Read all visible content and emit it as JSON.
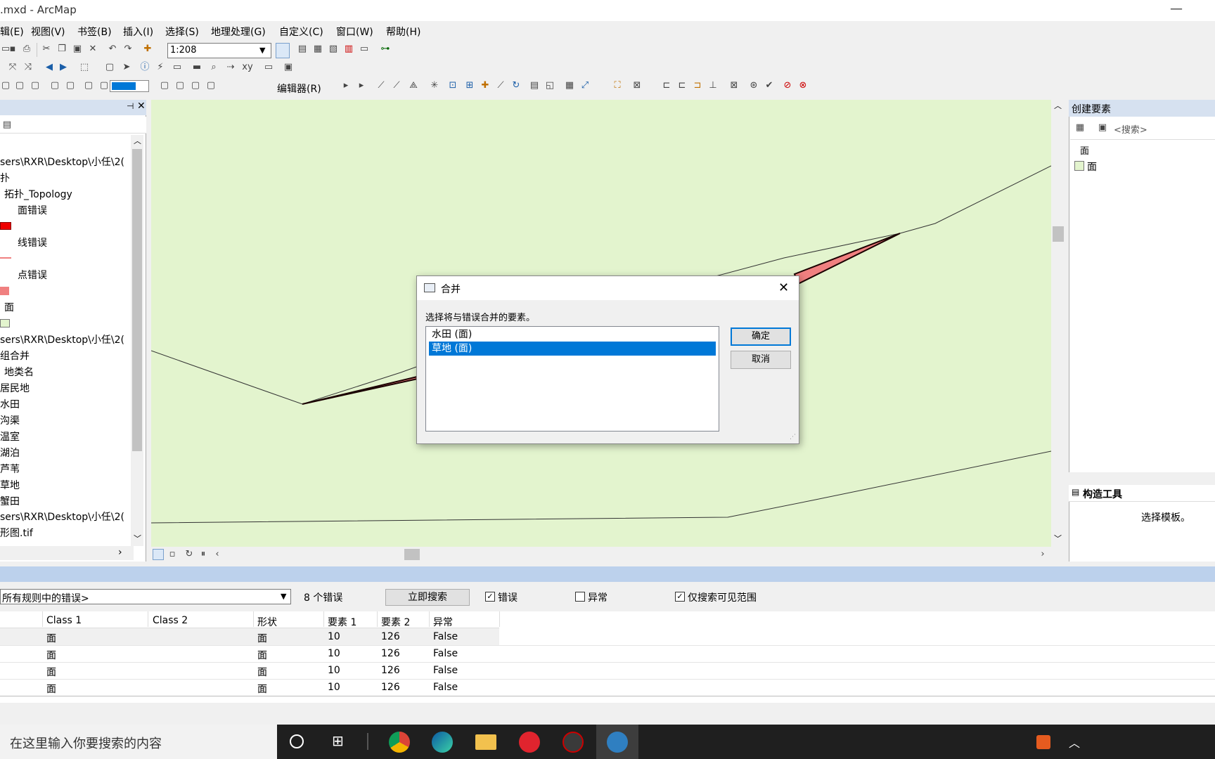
{
  "window": {
    "title": ".mxd - ArcMap",
    "minimize_glyph": "—"
  },
  "menu": [
    "辑(E)",
    "视图(V)",
    "书签(B)",
    "插入(I)",
    "选择(S)",
    "地理处理(G)",
    "自定义(C)",
    "窗口(W)",
    "帮助(H)"
  ],
  "toolbar": {
    "scale": "1:208",
    "editor": "编辑器(R)"
  },
  "toc": {
    "lines": [
      "sers\\RXR\\Desktop\\小任\\2(",
      "扑",
      "拓扑_Topology",
      "面错误",
      "线错误",
      "点错误",
      "面",
      "sers\\RXR\\Desktop\\小任\\2(",
      "组合并",
      "地类名",
      "居民地",
      "水田",
      "沟渠",
      "温室",
      "湖泊",
      "芦苇",
      "草地",
      "蟹田",
      "sers\\RXR\\Desktop\\小任\\2(",
      "形图.tif"
    ]
  },
  "create_features": {
    "title": "创建要素",
    "search_placeholder": "<搜索>",
    "group": "面",
    "template": "面"
  },
  "construct_tools": {
    "title": "构造工具",
    "hint": "选择模板。"
  },
  "errors": {
    "rule": "所有规则中的错误>",
    "count": "8 个错误",
    "search_button": "立即搜索",
    "chk_errors": "错误",
    "chk_exceptions": "异常",
    "chk_visible": "仅搜索可见范围",
    "columns": [
      "Class 1",
      "Class 2",
      "形状",
      "要素 1",
      "要素 2",
      "异常"
    ],
    "rows": [
      [
        "面",
        "",
        "面",
        "10",
        "126",
        "False"
      ],
      [
        "面",
        "",
        "面",
        "10",
        "126",
        "False"
      ],
      [
        "面",
        "",
        "面",
        "10",
        "126",
        "False"
      ],
      [
        "面",
        "",
        "面",
        "10",
        "126",
        "False"
      ]
    ]
  },
  "dialog": {
    "title": "合并",
    "prompt": "选择将与错误合并的要素。",
    "options": [
      "水田 (面)",
      "草地 (面)"
    ],
    "selected_index": 1,
    "ok": "确定",
    "cancel": "取消"
  },
  "taskbar": {
    "search_placeholder": "在这里输入你要搜索的内容"
  },
  "colors": {
    "map_fill": "#e3f4ce",
    "error_polygon": "#f08080",
    "selection": "#0078d7"
  }
}
